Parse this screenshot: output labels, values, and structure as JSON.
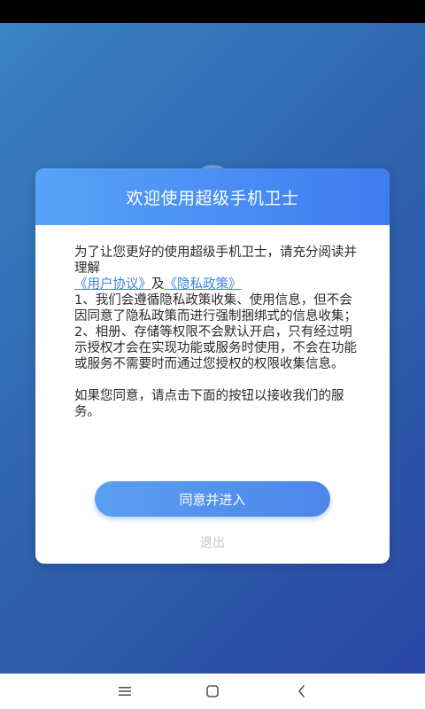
{
  "dialog": {
    "title": "欢迎使用超级手机卫士",
    "intro_text": "为了让您更好的使用超级手机卫士，请充分阅读并理解",
    "user_agreement_link": "《用户协议》",
    "and_text": "及",
    "privacy_policy_link": "《隐私政策》",
    "point_1": "1、我们会遵循隐私政策收集、使用信息，但不会因同意了隐私政策而进行强制捆绑式的信息收集；",
    "point_2": "2、相册、存储等权限不会默认开启，只有经过明示授权才会在实现功能或服务时使用，不会在功能或服务不需要时而通过您授权的权限收集信息。",
    "closing_text": "如果您同意，请点击下面的按钮以接收我们的服务。",
    "agree_button_label": "同意并进入",
    "exit_label": "退出"
  },
  "navigation": {
    "menu_icon": "menu-icon",
    "home_icon": "home-icon",
    "back_icon": "back-icon"
  },
  "colors": {
    "background_gradient_start": "#3a83c2",
    "background_gradient_end": "#2a47a4",
    "header_gradient_start": "#57a3f7",
    "header_gradient_end": "#3f7cf0",
    "link": "#3c83e6",
    "exit_text": "#c4c4c4"
  }
}
